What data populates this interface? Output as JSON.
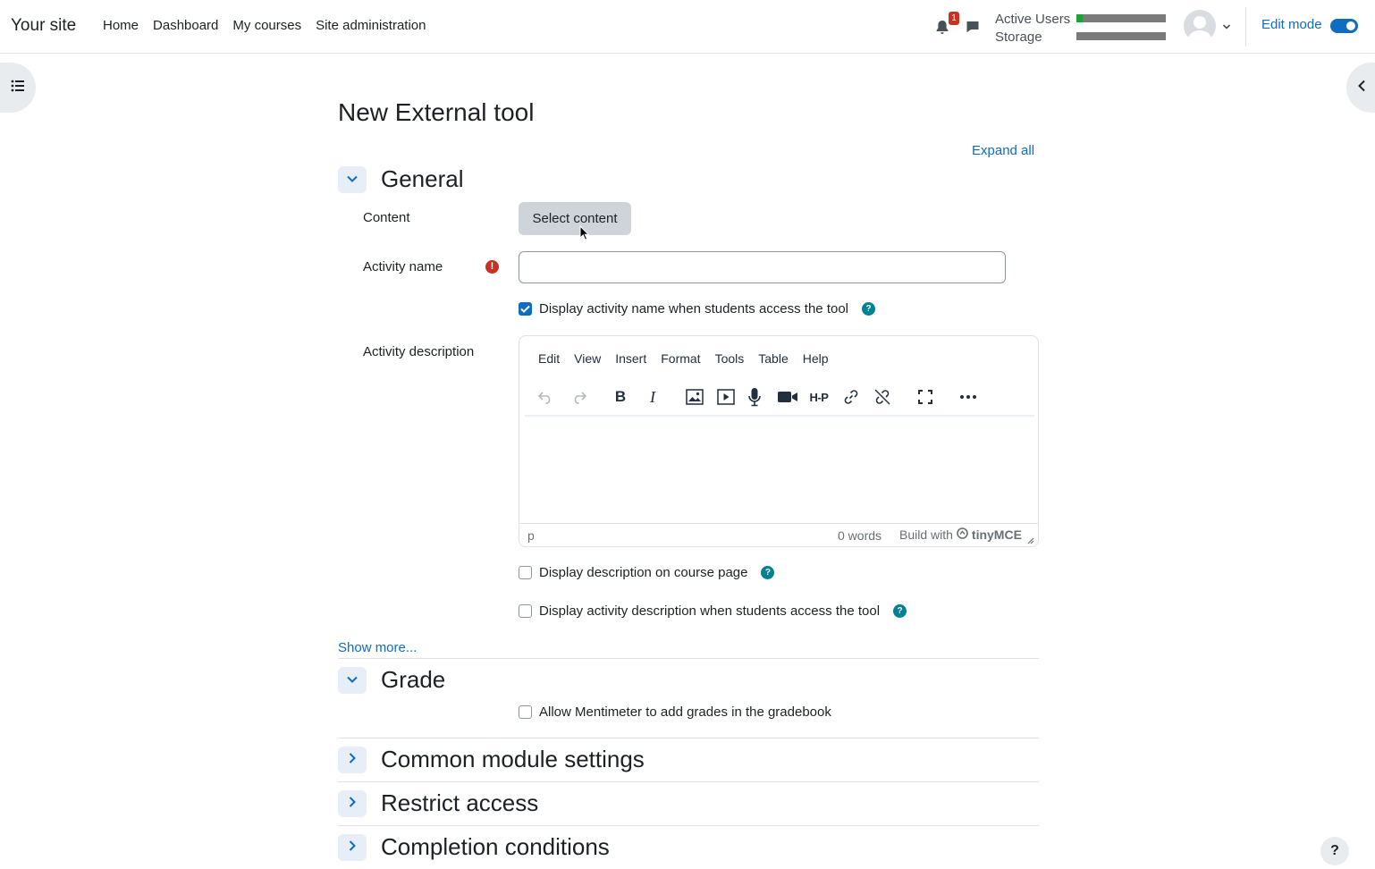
{
  "site_name": "Your site",
  "nav": {
    "items": [
      "Home",
      "Dashboard",
      "My courses",
      "Site administration"
    ],
    "notification_count": "1",
    "usage": {
      "active_users_label": "Active Users",
      "storage_label": "Storage",
      "active_users_fraction": 0.07,
      "storage_fraction": 0.0,
      "fill_color": "#1aa33a"
    },
    "edit_mode_label": "Edit mode",
    "edit_mode_on": true
  },
  "page": {
    "title": "New External tool",
    "expand_all": "Expand all"
  },
  "general": {
    "title": "General",
    "content_label": "Content",
    "select_content_button": "Select content",
    "activity_name_label": "Activity name",
    "activity_name_value": "",
    "display_name_check": "Display activity name when students access the tool",
    "activity_description_label": "Activity description",
    "display_description_check": "Display description on course page",
    "display_activity_description_check": "Display activity description when students access the tool",
    "show_more": "Show more..."
  },
  "editor": {
    "menus": [
      "Edit",
      "View",
      "Insert",
      "Format",
      "Tools",
      "Table",
      "Help"
    ],
    "status_path": "p",
    "word_count": "0 words",
    "built_with": "Build with",
    "brand": "tinyMCE"
  },
  "grade": {
    "title": "Grade",
    "allow_grades_check": "Allow Mentimeter to add grades in the gradebook"
  },
  "collapsed_sections": [
    "Common module settings",
    "Restrict access",
    "Completion conditions"
  ],
  "help_button": "?",
  "colors": {
    "accent": "#0f6cbf",
    "required": "#ca3120",
    "help": "#008196"
  }
}
